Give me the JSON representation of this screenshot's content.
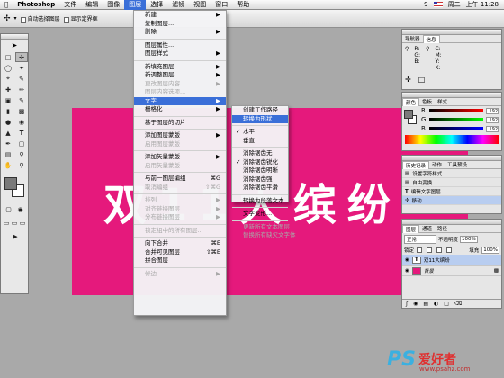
{
  "menubar": {
    "app": "Photoshop",
    "items": [
      "文件",
      "编辑",
      "图像",
      "图层",
      "选择",
      "滤镜",
      "视图",
      "窗口",
      "帮助"
    ],
    "active_index": 3,
    "badge": "9",
    "day": "周二",
    "time": "上午 11:28"
  },
  "options": {
    "auto_select": "自动选择图层",
    "show_bounds": "显示定界框"
  },
  "canvas": {
    "text": "双11大缤纷",
    "bg": "#e5197c"
  },
  "layer_menu": {
    "items": [
      {
        "label": "新建",
        "arrow": "▶",
        "dis": false
      },
      {
        "label": "复制图层...",
        "dis": false
      },
      {
        "label": "删除",
        "arrow": "▶",
        "dis": false
      },
      {
        "sep": true
      },
      {
        "label": "图层属性...",
        "dis": false
      },
      {
        "label": "图层样式",
        "arrow": "▶",
        "dis": false
      },
      {
        "sep": true
      },
      {
        "label": "新填充图层",
        "arrow": "▶",
        "dis": false
      },
      {
        "label": "新调整图层",
        "arrow": "▶",
        "dis": false
      },
      {
        "label": "更改图层内容",
        "arrow": "▶",
        "dis": true
      },
      {
        "label": "图层内容选项...",
        "dis": true
      },
      {
        "label": "文字",
        "arrow": "▶",
        "hl": true
      },
      {
        "label": "栅格化",
        "arrow": "▶",
        "dis": false
      },
      {
        "sep": true
      },
      {
        "label": "基于图层的切片",
        "dis": false
      },
      {
        "sep": true
      },
      {
        "label": "添加图层蒙版",
        "arrow": "▶",
        "dis": false
      },
      {
        "label": "启用图层蒙版",
        "dis": true
      },
      {
        "sep": true
      },
      {
        "label": "添加矢量蒙版",
        "arrow": "▶",
        "dis": false
      },
      {
        "label": "启用矢量蒙版",
        "dis": true
      },
      {
        "sep": true
      },
      {
        "label": "与前一图层编组",
        "shortcut": "⌘G",
        "dis": false
      },
      {
        "label": "取消编组",
        "shortcut": "⇧⌘G",
        "dis": true
      },
      {
        "sep": true
      },
      {
        "label": "排列",
        "arrow": "▶",
        "dis": true
      },
      {
        "label": "对齐链接图层",
        "arrow": "▶",
        "dis": true
      },
      {
        "label": "分布链接图层",
        "arrow": "▶",
        "dis": true
      },
      {
        "sep": true
      },
      {
        "label": "锁定组中的所有图层...",
        "dis": true
      },
      {
        "sep": true
      },
      {
        "label": "向下合并",
        "shortcut": "⌘E",
        "dis": false
      },
      {
        "label": "合并可见图层",
        "shortcut": "⇧⌘E",
        "dis": false
      },
      {
        "label": "拼合图层",
        "dis": false
      },
      {
        "sep": true
      },
      {
        "label": "修边",
        "arrow": "▶",
        "dis": true
      }
    ]
  },
  "text_menu": {
    "items": [
      {
        "label": "创建工作路径"
      },
      {
        "label": "转换为形状",
        "hl": true
      },
      {
        "sep": true
      },
      {
        "label": "水平",
        "check": "✓"
      },
      {
        "label": "垂直"
      },
      {
        "sep": true
      },
      {
        "label": "消除锯齿无"
      },
      {
        "label": "消除锯齿锐化",
        "check": "✓"
      },
      {
        "label": "消除锯齿明晰"
      },
      {
        "label": "消除锯齿强"
      },
      {
        "label": "消除锯齿平滑"
      },
      {
        "sep": true
      },
      {
        "label": "转换为段落文本"
      },
      {
        "sep": true
      },
      {
        "label": "文字变形..."
      },
      {
        "sep": true
      },
      {
        "label": "更新所有文本图层",
        "dis": true
      },
      {
        "label": "替换所有缺欠文字体",
        "dis": true
      }
    ]
  },
  "nav_panel": {
    "tabs": [
      "导航器",
      "信息"
    ],
    "cells": [
      "R:",
      "G:",
      "B:",
      "C:",
      "M:",
      "Y:",
      "K:"
    ]
  },
  "color_panel": {
    "tabs": [
      "颜色",
      "色板",
      "样式"
    ],
    "r": "192",
    "g": "192",
    "b": "192",
    "lr": "R",
    "lg": "G",
    "lb": "B"
  },
  "history_panel": {
    "tabs": [
      "历史记录",
      "动作",
      "工具预设"
    ],
    "rows": [
      "设置字符样式",
      "自由变换",
      "编辑文字图层",
      "移动"
    ],
    "selected": 3
  },
  "layers_panel": {
    "tabs": [
      "图层",
      "通道",
      "路径"
    ],
    "mode": "正常",
    "opacity_label": "不透明度",
    "opacity": "100%",
    "lock": "锁定",
    "fill_label": "填充",
    "fill": "100%",
    "rows": [
      "双11大缤纷",
      "背景"
    ],
    "selected": 0
  },
  "watermark": {
    "ps": "PS",
    "cn": "爱好者",
    "url": "www.psahz.com"
  }
}
